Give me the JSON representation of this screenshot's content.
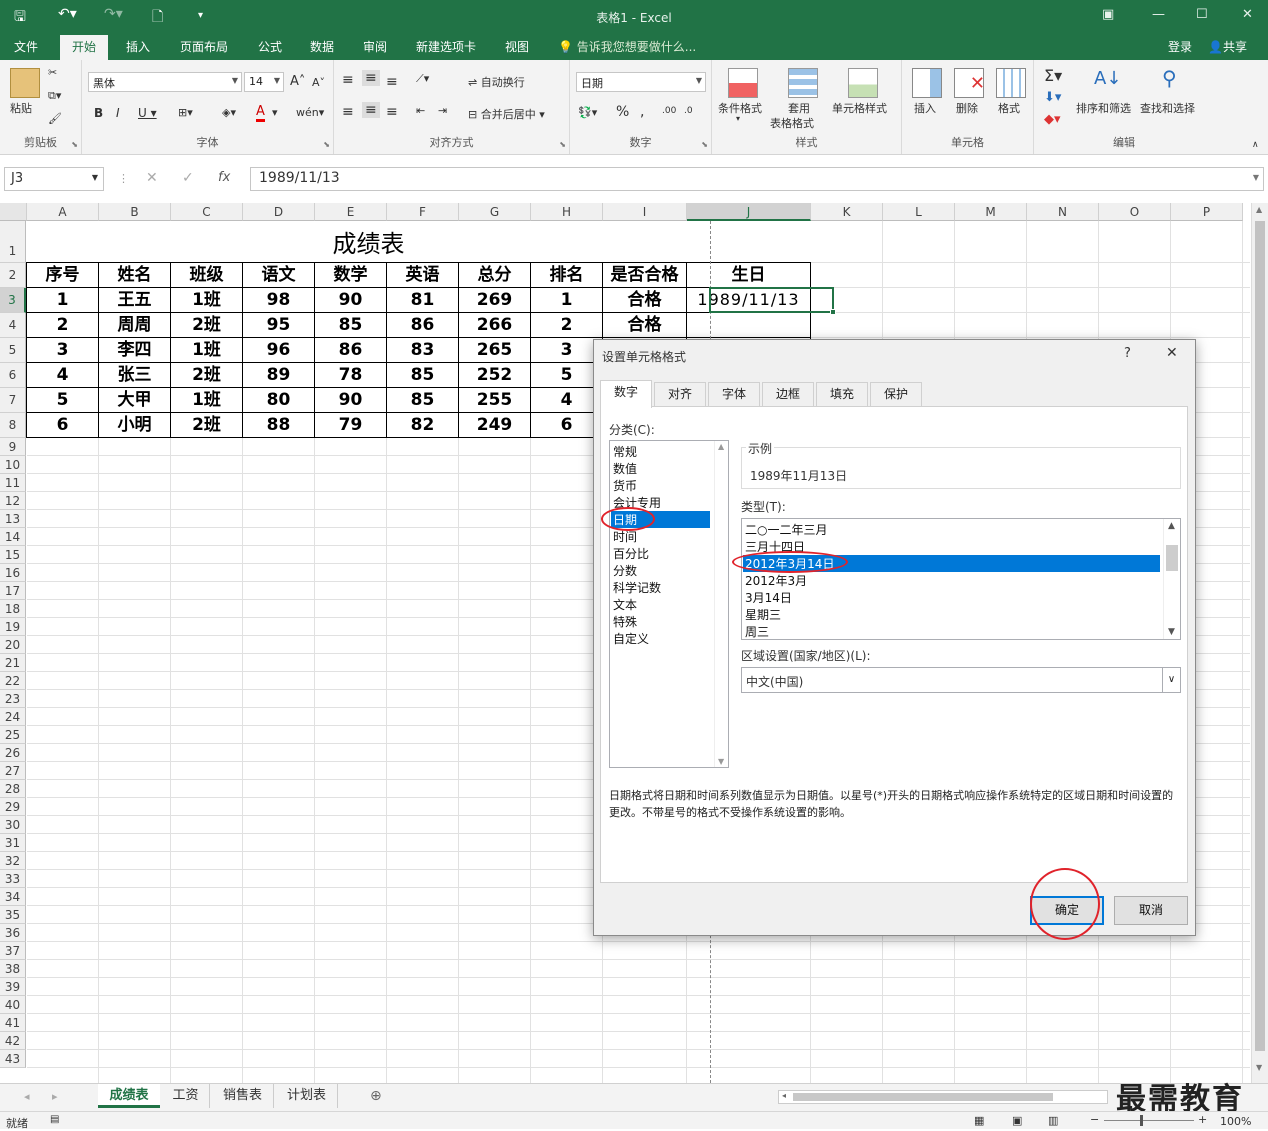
{
  "window": {
    "title": "表格1 - Excel"
  },
  "ribbon_tabs": [
    "文件",
    "开始",
    "插入",
    "页面布局",
    "公式",
    "数据",
    "审阅",
    "新建选项卡",
    "视图"
  ],
  "tell_me": "告诉我您想要做什么...",
  "account": {
    "login": "登录",
    "share": "共享"
  },
  "ribbon": {
    "clipboard": {
      "label": "剪贴板",
      "paste": "粘贴"
    },
    "font": {
      "label": "字体",
      "name": "黑体",
      "size": "14"
    },
    "align": {
      "label": "对齐方式",
      "wrap": "自动换行",
      "merge": "合并后居中"
    },
    "number": {
      "label": "数字",
      "format": "日期"
    },
    "styles": {
      "label": "样式",
      "cond": "条件格式",
      "table1": "套用",
      "table2": "表格格式",
      "cell": "单元格样式"
    },
    "cells": {
      "label": "单元格",
      "insert": "插入",
      "delete": "删除",
      "format": "格式"
    },
    "editing": {
      "label": "编辑",
      "sort": "排序和筛选",
      "find": "查找和选择"
    }
  },
  "formula_bar": {
    "name_box": "J3",
    "value": "1989/11/13"
  },
  "columns": [
    "A",
    "B",
    "C",
    "D",
    "E",
    "F",
    "G",
    "H",
    "I",
    "J",
    "K",
    "L",
    "M",
    "N",
    "O",
    "P"
  ],
  "sheet": {
    "title": "成绩表",
    "headers": [
      "序号",
      "姓名",
      "班级",
      "语文",
      "数学",
      "英语",
      "总分",
      "排名",
      "是否合格",
      "生日"
    ],
    "rows": [
      [
        "1",
        "王五",
        "1班",
        "98",
        "90",
        "81",
        "269",
        "1",
        "合格",
        "1989/11/13"
      ],
      [
        "2",
        "周周",
        "2班",
        "95",
        "85",
        "86",
        "266",
        "2",
        "合格",
        ""
      ],
      [
        "3",
        "李四",
        "1班",
        "96",
        "86",
        "83",
        "265",
        "3",
        "",
        ""
      ],
      [
        "4",
        "张三",
        "2班",
        "89",
        "78",
        "85",
        "252",
        "5",
        "",
        ""
      ],
      [
        "5",
        "大甲",
        "1班",
        "80",
        "90",
        "85",
        "255",
        "4",
        "",
        ""
      ],
      [
        "6",
        "小明",
        "2班",
        "88",
        "79",
        "82",
        "249",
        "6",
        "",
        ""
      ]
    ]
  },
  "sheet_tabs": [
    "成绩表",
    "工资",
    "销售表",
    "计划表"
  ],
  "status": {
    "ready": "就绪",
    "zoom": "100%"
  },
  "watermark": "最需教育",
  "dialog": {
    "title": "设置单元格格式",
    "help": "?",
    "tabs": [
      "数字",
      "对齐",
      "字体",
      "边框",
      "填充",
      "保护"
    ],
    "category_label": "分类(C):",
    "categories": [
      "常规",
      "数值",
      "货币",
      "会计专用",
      "日期",
      "时间",
      "百分比",
      "分数",
      "科学记数",
      "文本",
      "特殊",
      "自定义"
    ],
    "selected_category": "日期",
    "sample_label": "示例",
    "sample_value": "1989年11月13日",
    "type_label": "类型(T):",
    "types": [
      "二○一二年三月",
      "三月十四日",
      "2012年3月14日",
      "2012年3月",
      "3月14日",
      "星期三",
      "周三"
    ],
    "locale_label": "区域设置(国家/地区)(L):",
    "locale_value": "中文(中国)",
    "description": "日期格式将日期和时间系列数值显示为日期值。以星号(*)开头的日期格式响应操作系统特定的区域日期和时间设置的更改。不带星号的格式不受操作系统设置的影响。",
    "ok": "确定",
    "cancel": "取消"
  },
  "colors": {
    "excel_green": "#217346",
    "selection": "#0078d7",
    "annotation_red": "#e0232b"
  }
}
